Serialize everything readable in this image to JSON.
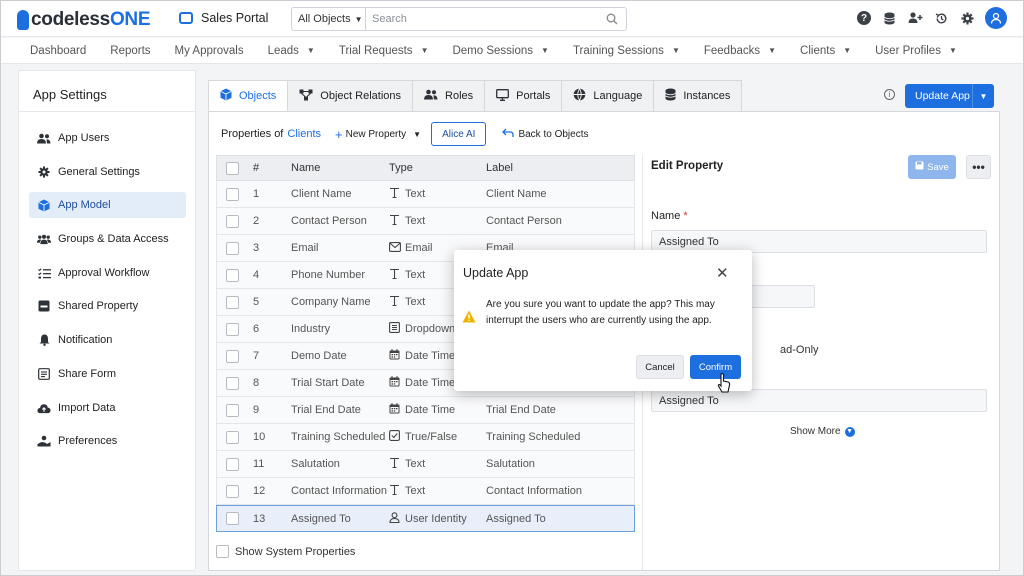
{
  "topbar": {
    "logo_prefix": "codeless",
    "logo_suffix": "ONE",
    "app_name": "Sales Portal",
    "object_select": "All Objects",
    "search_placeholder": "Search"
  },
  "nav": [
    "Dashboard",
    "Reports",
    "My Approvals",
    "Leads",
    "Trial Requests",
    "Demo Sessions",
    "Training Sessions",
    "Feedbacks",
    "Clients",
    "User Profiles"
  ],
  "sidebar": {
    "title": "App Settings",
    "items": [
      {
        "label": "App Users",
        "icon": "users-icon"
      },
      {
        "label": "General Settings",
        "icon": "gear-icon"
      },
      {
        "label": "App Model",
        "icon": "cube-icon"
      },
      {
        "label": "Groups & Data Access",
        "icon": "group-icon"
      },
      {
        "label": "Approval Workflow",
        "icon": "checklist-icon"
      },
      {
        "label": "Shared Property",
        "icon": "inbox-icon"
      },
      {
        "label": "Notification",
        "icon": "bell-icon"
      },
      {
        "label": "Share Form",
        "icon": "form-icon"
      },
      {
        "label": "Import Data",
        "icon": "cloud-upload-icon"
      },
      {
        "label": "Preferences",
        "icon": "hand-icon"
      }
    ]
  },
  "tabs": [
    "Objects",
    "Object Relations",
    "Roles",
    "Portals",
    "Language",
    "Instances"
  ],
  "update_app_label": "Update App",
  "toolbar": {
    "properties_of": "Properties of",
    "object_name": "Clients",
    "new_property": "New Property",
    "alice_ai": "Alice AI",
    "back": "Back to Objects"
  },
  "table": {
    "headers": {
      "num": "#",
      "name": "Name",
      "type": "Type",
      "label": "Label"
    },
    "rows": [
      {
        "num": "1",
        "name": "Client Name",
        "type": "Text",
        "label": "Client Name"
      },
      {
        "num": "2",
        "name": "Contact Person",
        "type": "Text",
        "label": "Contact Person"
      },
      {
        "num": "3",
        "name": "Email",
        "type": "Email",
        "label": "Email"
      },
      {
        "num": "4",
        "name": "Phone Number",
        "type": "Text",
        "label": ""
      },
      {
        "num": "5",
        "name": "Company Name",
        "type": "Text",
        "label": ""
      },
      {
        "num": "6",
        "name": "Industry",
        "type": "Dropdown",
        "label": ""
      },
      {
        "num": "7",
        "name": "Demo Date",
        "type": "Date Time",
        "label": ""
      },
      {
        "num": "8",
        "name": "Trial Start Date",
        "type": "Date Time",
        "label": ""
      },
      {
        "num": "9",
        "name": "Trial End Date",
        "type": "Date Time",
        "label": "Trial End Date"
      },
      {
        "num": "10",
        "name": "Training Scheduled",
        "type": "True/False",
        "label": "Training Scheduled"
      },
      {
        "num": "11",
        "name": "Salutation",
        "type": "Text",
        "label": "Salutation"
      },
      {
        "num": "12",
        "name": "Contact Information",
        "type": "Text",
        "label": "Contact Information"
      },
      {
        "num": "13",
        "name": "Assigned To",
        "type": "User Identity",
        "label": "Assigned To"
      }
    ],
    "show_system": "Show System Properties"
  },
  "edit_property": {
    "title": "Edit Property",
    "save": "Save",
    "name_label": "Name",
    "name_required": "*",
    "name_value": "Assigned To",
    "read_only_partial": "ad-Only",
    "label_value": "Assigned To",
    "show_more": "Show More"
  },
  "modal": {
    "title": "Update App",
    "message": "Are you sure you want to update the app? This may interrupt the users who are currently using the app.",
    "cancel": "Cancel",
    "confirm": "Confirm"
  },
  "colors": {
    "accent": "#1d6fe0",
    "warning": "#f0b400"
  }
}
